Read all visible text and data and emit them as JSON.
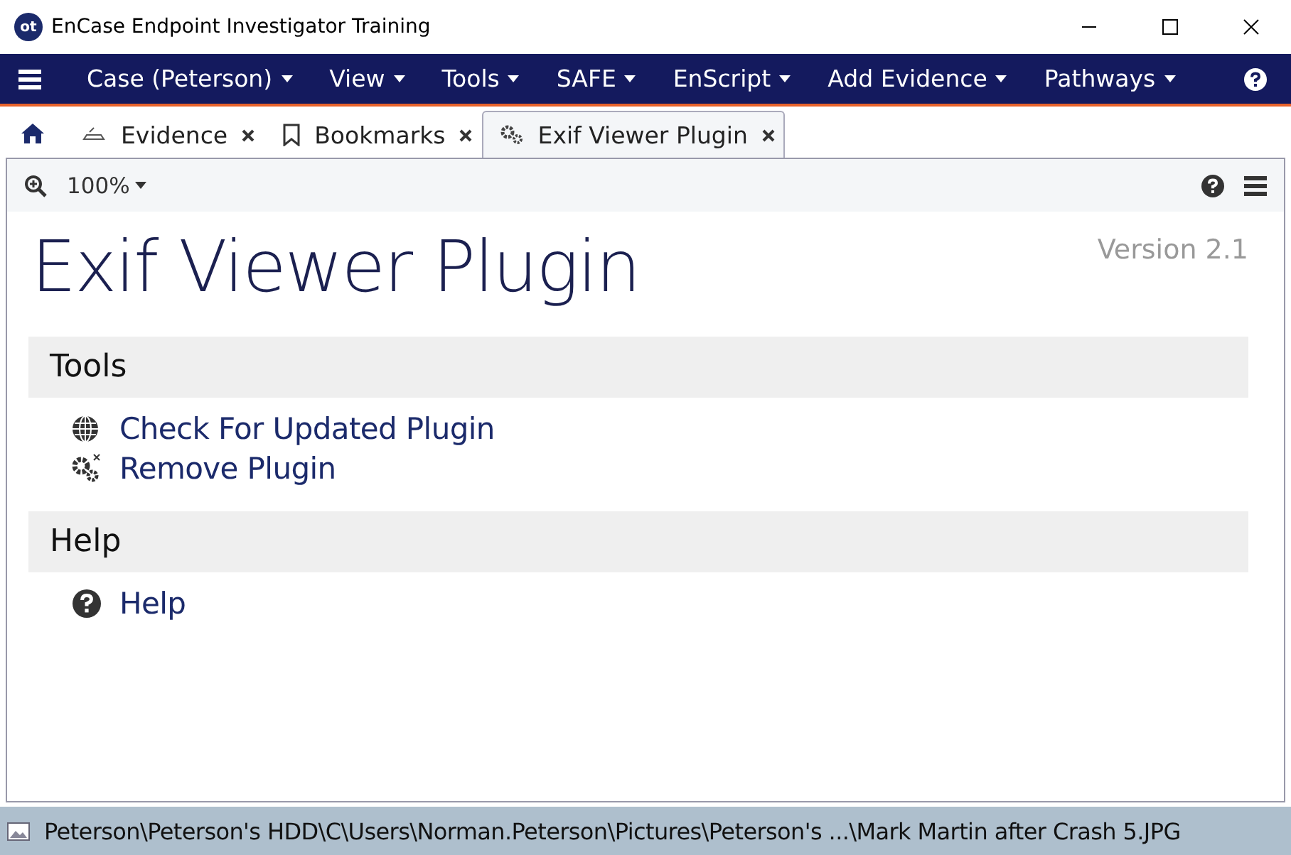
{
  "window": {
    "title": "EnCase Endpoint Investigator Training",
    "logo": "ot"
  },
  "menu": [
    {
      "label": "Case (Peterson)"
    },
    {
      "label": "View"
    },
    {
      "label": "Tools"
    },
    {
      "label": "SAFE"
    },
    {
      "label": "EnScript"
    },
    {
      "label": "Add Evidence"
    },
    {
      "label": "Pathways"
    }
  ],
  "tabs": [
    {
      "kind": "evidence",
      "label": "Evidence",
      "selected": false
    },
    {
      "kind": "bookmark",
      "label": "Bookmarks",
      "selected": false
    },
    {
      "kind": "gears",
      "label": "Exif Viewer Plugin",
      "selected": true
    }
  ],
  "toolbar": {
    "zoom": "100%"
  },
  "page": {
    "title": "Exif Viewer Plugin",
    "version": "Version 2.1",
    "sections": [
      {
        "title": "Tools",
        "items": [
          {
            "kind": "globe",
            "label": "Check For Updated Plugin"
          },
          {
            "kind": "gears",
            "label": "Remove Plugin"
          }
        ]
      },
      {
        "title": "Help",
        "items": [
          {
            "kind": "help",
            "label": "Help"
          }
        ]
      }
    ]
  },
  "status_bar": {
    "path": "Peterson\\Peterson's HDD\\C\\Users\\Norman.Peterson\\Pictures\\Peterson's ...\\Mark Martin after Crash 5.JPG"
  }
}
